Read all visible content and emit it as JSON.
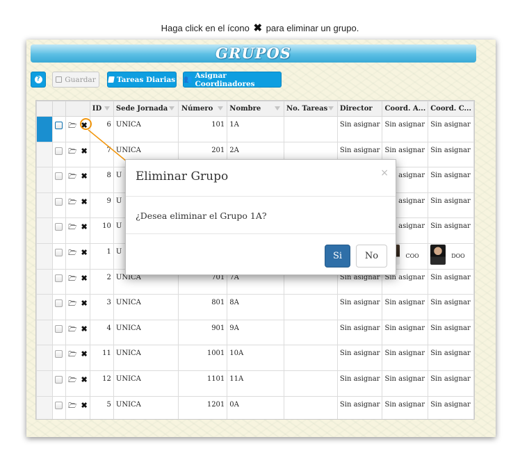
{
  "caption": {
    "before": "Haga click en el ícono",
    "icon": "✖",
    "after": "para eliminar un grupo."
  },
  "title": "GRUPOS",
  "toolbar": {
    "help_icon": "?",
    "save_label": "Guardar",
    "tasks_label": "Tareas Diarias",
    "assign_label": "Asignar Coordinadores"
  },
  "columns": [
    "ID",
    "Sede Jornada",
    "Número",
    "Nombre",
    "No. Tareas",
    "Director",
    "Coord. A...",
    "Coord. C..."
  ],
  "rows": [
    {
      "id": "6",
      "sede": "UNICA",
      "numero": "101",
      "nombre": "1A",
      "tareas": "",
      "director": "Sin asignar",
      "coord_a": "Sin asignar",
      "coord_c": "Sin asignar"
    },
    {
      "id": "7",
      "sede": "UNICA",
      "numero": "201",
      "nombre": "2A",
      "tareas": "",
      "director": "Sin asignar",
      "coord_a": "Sin asignar",
      "coord_c": "Sin asignar"
    },
    {
      "id": "8",
      "sede": "U",
      "numero": "",
      "nombre": "",
      "tareas": "",
      "director": "",
      "coord_a": "Sin asignar",
      "coord_c": "Sin asignar"
    },
    {
      "id": "9",
      "sede": "U",
      "numero": "",
      "nombre": "",
      "tareas": "",
      "director": "",
      "coord_a": "Sin asignar",
      "coord_c": "Sin asignar"
    },
    {
      "id": "10",
      "sede": "U",
      "numero": "",
      "nombre": "",
      "tareas": "",
      "director": "",
      "coord_a": "Sin asignar",
      "coord_c": "Sin asignar"
    },
    {
      "id": "1",
      "sede": "U",
      "numero": "",
      "nombre": "",
      "tareas": "",
      "director": "",
      "coord_a": "COO",
      "coord_c": "DOO"
    },
    {
      "id": "2",
      "sede": "UNICA",
      "numero": "701",
      "nombre": "7A",
      "tareas": "",
      "director": "Sin asignar",
      "coord_a": "Sin asignar",
      "coord_c": "Sin asignar"
    },
    {
      "id": "3",
      "sede": "UNICA",
      "numero": "801",
      "nombre": "8A",
      "tareas": "",
      "director": "Sin asignar",
      "coord_a": "Sin asignar",
      "coord_c": "Sin asignar"
    },
    {
      "id": "4",
      "sede": "UNICA",
      "numero": "901",
      "nombre": "9A",
      "tareas": "",
      "director": "Sin asignar",
      "coord_a": "Sin asignar",
      "coord_c": "Sin asignar"
    },
    {
      "id": "11",
      "sede": "UNICA",
      "numero": "1001",
      "nombre": "10A",
      "tareas": "",
      "director": "Sin asignar",
      "coord_a": "Sin asignar",
      "coord_c": "Sin asignar"
    },
    {
      "id": "12",
      "sede": "UNICA",
      "numero": "1101",
      "nombre": "11A",
      "tareas": "",
      "director": "Sin asignar",
      "coord_a": "Sin asignar",
      "coord_c": "Sin asignar"
    },
    {
      "id": "5",
      "sede": "UNICA",
      "numero": "1201",
      "nombre": "0A",
      "tareas": "",
      "director": "Sin asignar",
      "coord_a": "Sin asignar",
      "coord_c": "Sin asignar"
    }
  ],
  "icons": {
    "open": "folder-open-icon",
    "delete": "delete-x-icon"
  },
  "dialog": {
    "title": "Eliminar Grupo",
    "close": "×",
    "message": "¿Desea eliminar el Grupo 1A?",
    "yes": "Si",
    "no": "No"
  },
  "colors": {
    "accent": "#0e9ee0",
    "highlight": "#f2960c",
    "primary_button": "#2f6fa8"
  }
}
